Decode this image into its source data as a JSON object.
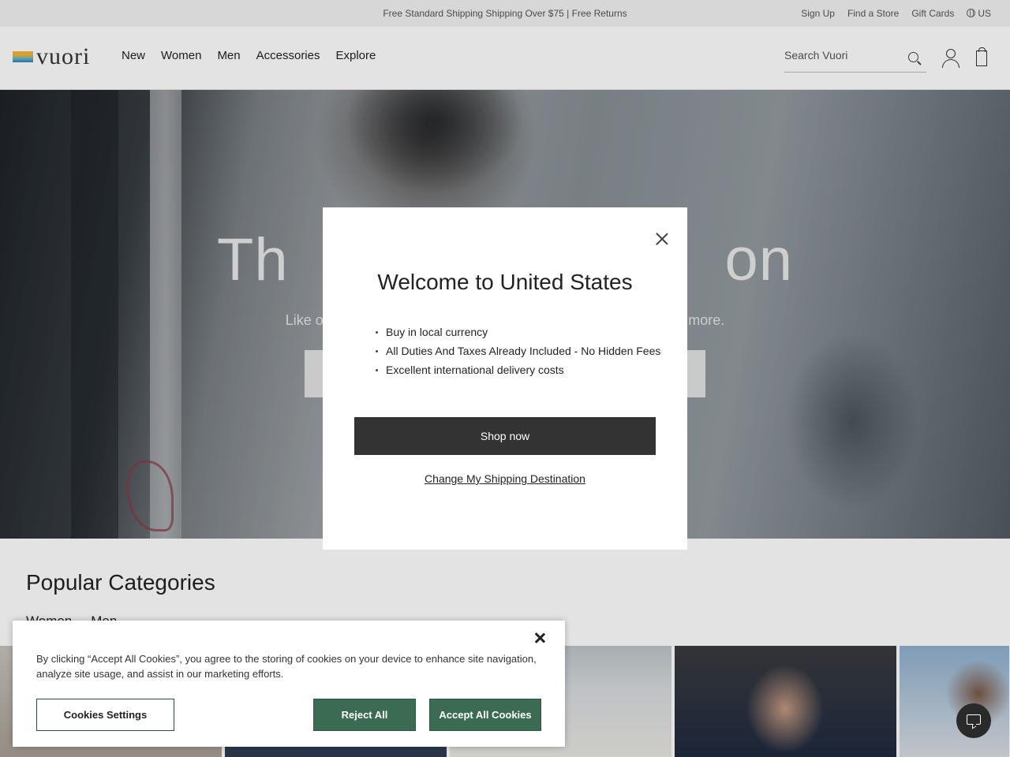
{
  "announcement": {
    "text": "Free Standard Shipping Shipping Over $75 | Free Returns",
    "links": [
      "Sign Up",
      "Find a Store",
      "Gift Cards"
    ],
    "region": "US"
  },
  "header": {
    "logo_text": "vuori",
    "nav": [
      "New",
      "Women",
      "Men",
      "Accessories",
      "Explore"
    ],
    "search_placeholder": "Search Vuori"
  },
  "hero": {
    "title": "Th                         on",
    "subtitle": "Like options? Y                                                              kets, and more."
  },
  "categories": {
    "title": "Popular Categories",
    "tabs": [
      "Women",
      "Men"
    ]
  },
  "modal": {
    "title": "Welcome to United States",
    "bullets": [
      "Buy in local currency",
      "All Duties And Taxes Already Included - No Hidden Fees",
      "Excellent international delivery costs"
    ],
    "primary_button": "Shop now",
    "secondary_link": "Change My Shipping Destination"
  },
  "cookie_banner": {
    "text": "By clicking “Accept All Cookies”, you agree to the storing of cookies on your device to enhance site navigation, analyze site usage, and assist in our marketing efforts.",
    "settings_button": "Cookies Settings",
    "reject_button": "Reject All",
    "accept_button": "Accept All Cookies"
  },
  "colors": {
    "primary_button": "#333333",
    "cookie_accent": "#3b6b52"
  }
}
